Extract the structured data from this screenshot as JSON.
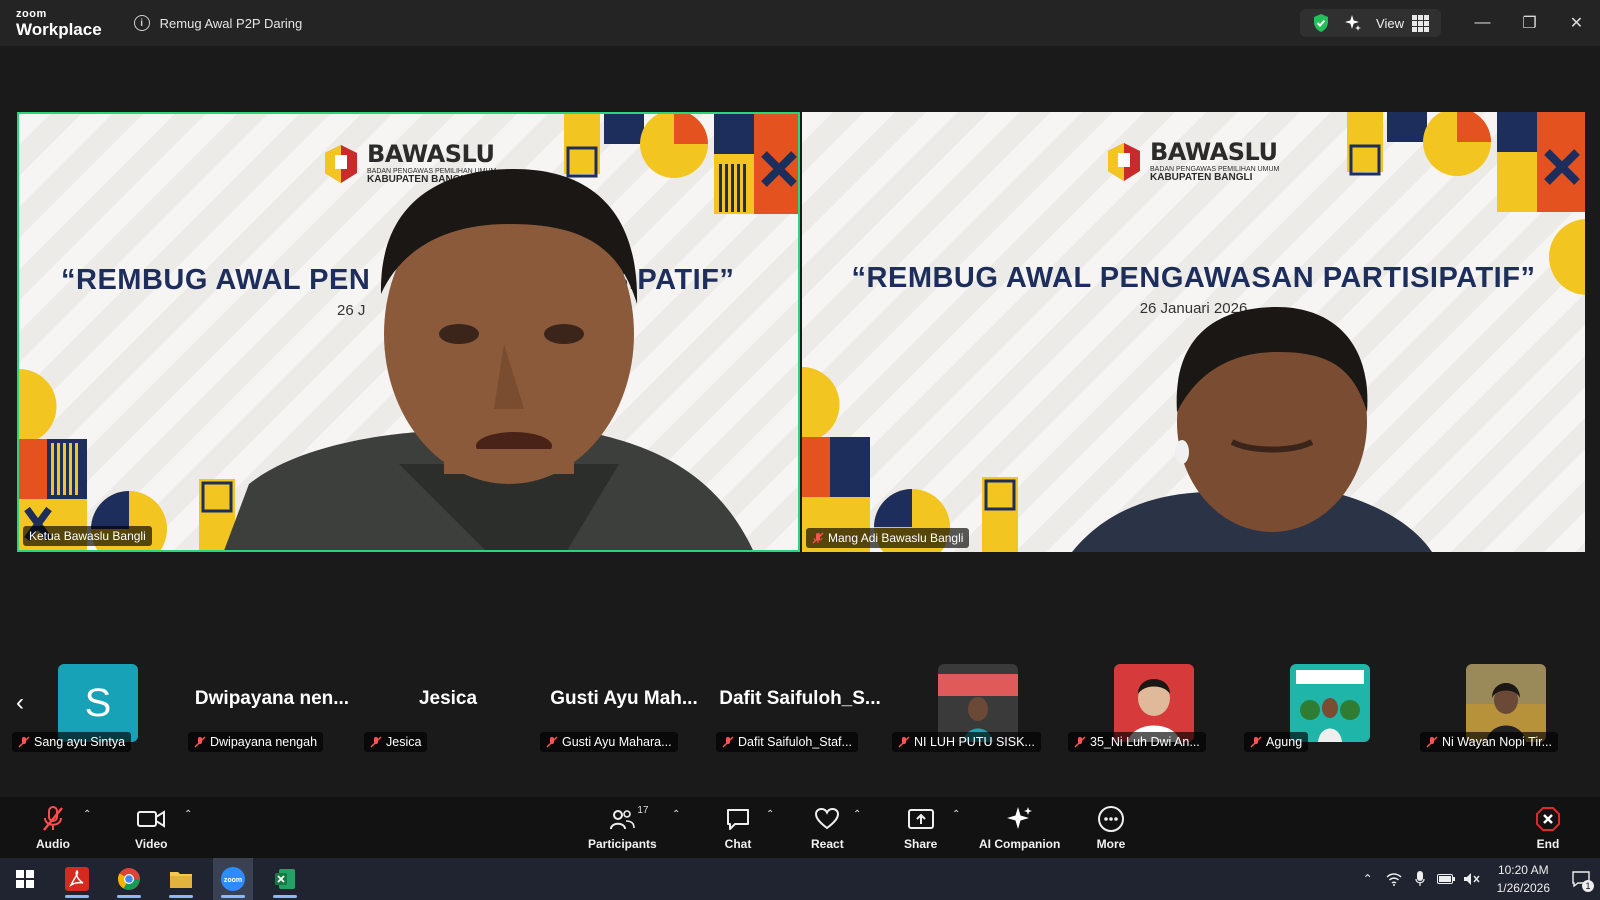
{
  "app": {
    "brand_small": "zoom",
    "brand_large": "Workplace",
    "meeting_title": "Remug Awal P2P Daring",
    "view_label": "View"
  },
  "window_controls": {
    "minimize": "—",
    "restore": "❐",
    "close": "✕"
  },
  "banner": {
    "org_name": "BAWASLU",
    "org_subtitle": "BADAN PENGAWAS PEMILIHAN UMUM",
    "org_region": "KABUPATEN BANGLI",
    "left_title": "“REMBUG AWAL PEN",
    "left_title_tail": "SIPATIF”",
    "left_date": "26 J",
    "right_title": "“REMBUG AWAL PENGAWASAN PARTISIPATIF”",
    "right_date": "26 Januari 2026"
  },
  "videos": [
    {
      "name": "Ketua Bawaslu Bangli",
      "muted": false,
      "active_speaker": true
    },
    {
      "name": "Mang Adi Bawaslu Bangli",
      "muted": true,
      "active_speaker": false
    }
  ],
  "filmstrip": {
    "prev_arrow": "‹",
    "participants": [
      {
        "display": "S",
        "label": "Sang ayu Sintya",
        "type": "avatar",
        "color": "#17a2b8"
      },
      {
        "display": "Dwipayana  nen...",
        "label": "Dwipayana nengah",
        "type": "name"
      },
      {
        "display": "Jesica",
        "label": "Jesica",
        "type": "name"
      },
      {
        "display": "Gusti Ayu  Mah...",
        "label": "Gusti Ayu  Mahara...",
        "type": "name"
      },
      {
        "display": "Dafit  Saifuloh_S...",
        "label": "Dafit Saifuloh_Staf...",
        "type": "name"
      },
      {
        "display": "",
        "label": "NI LUH PUTU SISK...",
        "type": "photo"
      },
      {
        "display": "",
        "label": "35_Ni Luh Dwi An...",
        "type": "photo"
      },
      {
        "display": "",
        "label": "Agung",
        "type": "photo"
      },
      {
        "display": "",
        "label": "Ni Wayan Nopi Tir...",
        "type": "photo"
      }
    ]
  },
  "toolbar": {
    "audio": "Audio",
    "video": "Video",
    "participants": "Participants",
    "participants_count": "17",
    "chat": "Chat",
    "react": "React",
    "share": "Share",
    "ai_companion": "AI Companion",
    "more": "More",
    "end": "End"
  },
  "taskbar": {
    "time": "10:20 AM",
    "date": "1/26/2026",
    "notifications": "1"
  },
  "colors": {
    "active_speaker": "#2ad67a",
    "end_red": "#e02828",
    "bg": "#1a1a1a",
    "banner_navy": "#1d2d5c"
  }
}
